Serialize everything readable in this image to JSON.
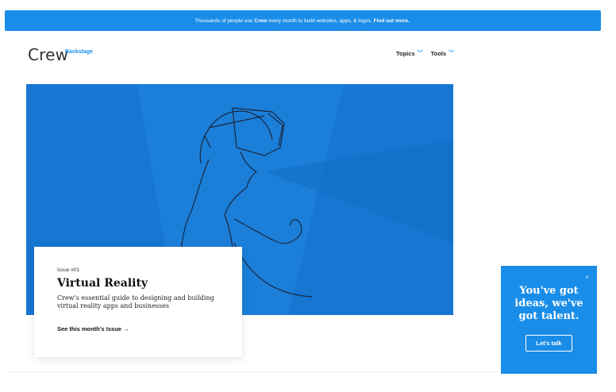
{
  "promo": {
    "text_before": "Thousands of people use",
    "brand": "Crew",
    "text_after": "every month to build websites, apps, & logos.",
    "link": "Find out more."
  },
  "header": {
    "logo": "Crew",
    "sub_logo": "Backstage",
    "nav": [
      {
        "label": "Topics"
      },
      {
        "label": "Tools"
      }
    ]
  },
  "feature": {
    "issue": "Issue #01",
    "title": "Virtual Reality",
    "description": "Crew's essential guide to designing and building virtual reality apps and businesses",
    "cta": "See this month's Issue →"
  },
  "chat_widget": {
    "heading": "You've got ideas, we've got talent.",
    "button": "Let's talk",
    "close": "×"
  },
  "colors": {
    "accent": "#1a8de8",
    "hero_background": "#1776d2"
  }
}
